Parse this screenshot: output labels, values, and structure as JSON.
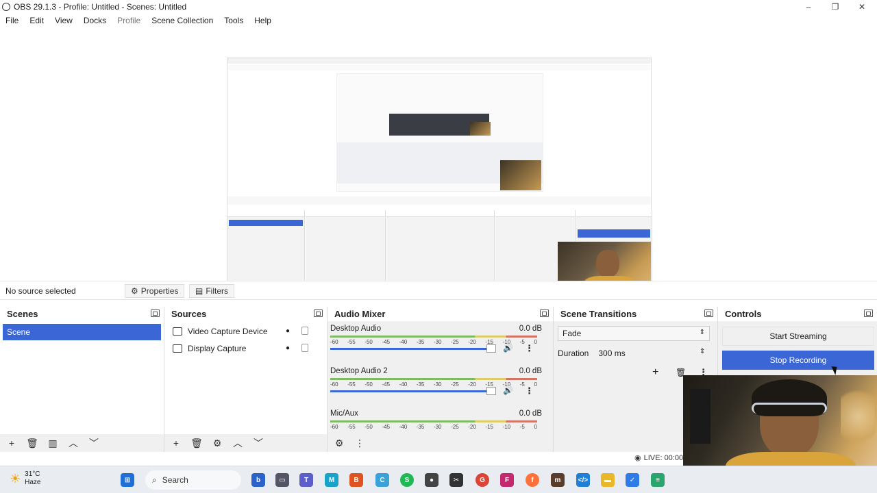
{
  "window": {
    "title": "OBS 29.1.3 - Profile: Untitled - Scenes: Untitled",
    "minimize": "–",
    "maximize": "❐",
    "close": "✕"
  },
  "menu": [
    "File",
    "Edit",
    "View",
    "Docks",
    "Profile",
    "Scene Collection",
    "Tools",
    "Help"
  ],
  "source_bar": {
    "status": "No source selected",
    "properties": "Properties",
    "filters": "Filters"
  },
  "scenes": {
    "title": "Scenes",
    "items": [
      "Scene"
    ]
  },
  "sources": {
    "title": "Sources",
    "items": [
      {
        "name": "Video Capture Device",
        "icon": "camera-icon"
      },
      {
        "name": "Display Capture",
        "icon": "monitor-icon"
      }
    ]
  },
  "mixer": {
    "title": "Audio Mixer",
    "ticks": [
      "-60",
      "-55",
      "-50",
      "-45",
      "-40",
      "-35",
      "-30",
      "-25",
      "-20",
      "-15",
      "-10",
      "-5",
      "0"
    ],
    "channels": [
      {
        "name": "Desktop Audio",
        "level": "0.0 dB"
      },
      {
        "name": "Desktop Audio 2",
        "level": "0.0 dB"
      },
      {
        "name": "Mic/Aux",
        "level": "0.0 dB"
      }
    ]
  },
  "transitions": {
    "title": "Scene Transitions",
    "type": "Fade",
    "duration_label": "Duration",
    "duration_value": "300 ms"
  },
  "controls": {
    "title": "Controls",
    "start_streaming": "Start Streaming",
    "stop_recording": "Stop Recording"
  },
  "status": {
    "live": "LIVE: 00:00"
  },
  "taskbar": {
    "temp": "31°C",
    "weather": "Haze",
    "search": "Search"
  },
  "colors": {
    "accent": "#3b66d6"
  }
}
